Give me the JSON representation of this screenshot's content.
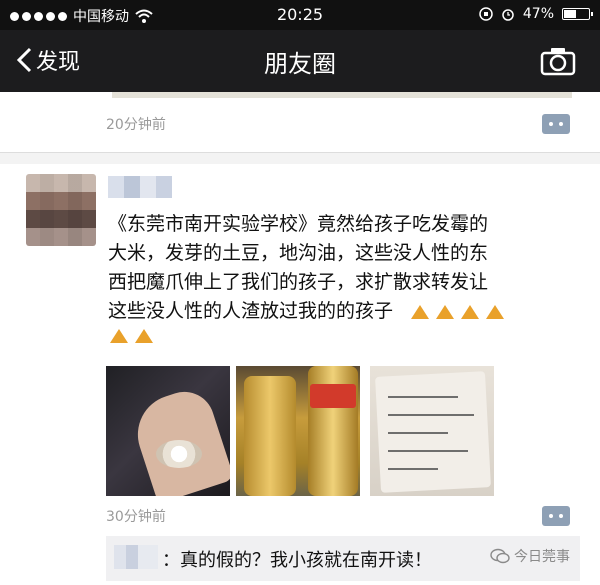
{
  "status_bar": {
    "carrier": "中国移动",
    "time": "20:25",
    "battery": "47%"
  },
  "nav": {
    "back_label": "发现",
    "title": "朋友圈"
  },
  "previous_post": {
    "time": "20分钟前"
  },
  "post": {
    "text_lines": [
      "《东莞市南开实验学校》竟然给孩子吃发霉的",
      "大米，发芽的土豆，地沟油，这些没人性的东",
      "西把魔爪伸上了我们的孩子，求扩散求转发让",
      "这些没人性的人渣放过我的的孩子"
    ],
    "time": "30分钟前"
  },
  "comment": {
    "text": "：真的假的？我小孩就在南开读！"
  },
  "watermark": "今日莞事"
}
